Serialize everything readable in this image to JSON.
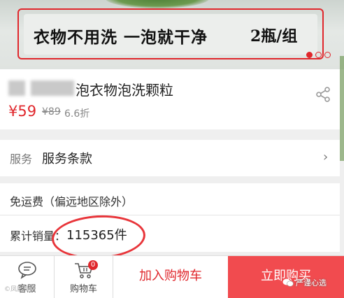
{
  "banner": {
    "slogan": "衣物不用洗 一泡就干净",
    "pack": "2瓶/组",
    "carousel": {
      "count": 3,
      "active_index": 0
    },
    "accent_color": "#e0272c"
  },
  "product": {
    "title": "泡衣物泡洗颗粒",
    "price": "¥59",
    "original_price": "¥89",
    "discount": "6.6折",
    "share_icon": "share-icon"
  },
  "service": {
    "label": "服务",
    "value": "服务条款",
    "chevron": "›"
  },
  "shipping": {
    "text": "免运费（偏远地区除外）"
  },
  "sales": {
    "label": "累计销量：",
    "value": "115365件",
    "highlight_color": "#e8353a"
  },
  "bottom_bar": {
    "service_label": "客服",
    "service_icon": "chat-bubble-icon",
    "cart_label": "购物车",
    "cart_icon": "cart-icon",
    "cart_badge": "0",
    "add_to_cart": "加入购物车",
    "buy_now": "立即购买",
    "buy_now_color": "#f14b4f"
  },
  "watermarks": {
    "left": "©凤凰新闻",
    "right": "严谨心选"
  }
}
